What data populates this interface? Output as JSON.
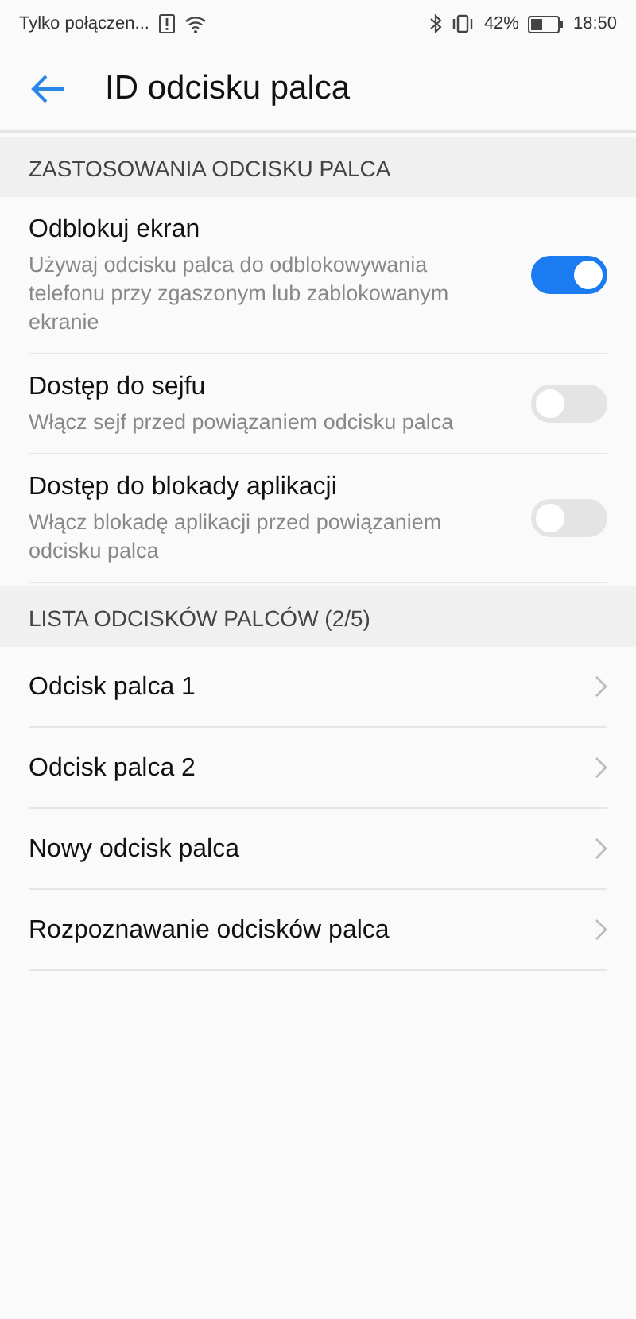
{
  "status_bar": {
    "carrier": "Tylko połączen...",
    "battery": "42%",
    "time": "18:50"
  },
  "header": {
    "title": "ID odcisku palca"
  },
  "sections": [
    {
      "title": "ZASTOSOWANIA ODCISKU PALCA",
      "items": [
        {
          "kind": "switch",
          "title": "Odblokuj ekran",
          "description": "Używaj odcisku palca do odblokowywania telefonu przy zgaszonym lub zablokowanym ekranie",
          "on": true
        },
        {
          "kind": "switch",
          "title": "Dostęp do sejfu",
          "description": "Włącz sejf przed powiązaniem odcisku palca",
          "on": false
        },
        {
          "kind": "switch",
          "title": "Dostęp do blokady aplikacji",
          "description": "Włącz blokadę aplikacji przed powiązaniem odcisku palca",
          "on": false
        }
      ]
    },
    {
      "title": "LISTA ODCISKÓW PALCÓW (2/5)",
      "items": [
        {
          "kind": "link",
          "title": "Odcisk palca 1"
        },
        {
          "kind": "link",
          "title": "Odcisk palca 2"
        },
        {
          "kind": "link",
          "title": "Nowy odcisk palca"
        },
        {
          "kind": "link",
          "title": "Rozpoznawanie odcisków palca"
        }
      ]
    }
  ]
}
